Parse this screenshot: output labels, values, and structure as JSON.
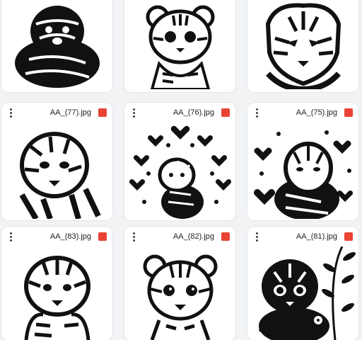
{
  "colors": {
    "background": "#f1f3f5",
    "card": "#ffffff",
    "image_badge": "#ea4335"
  },
  "files": [
    {
      "name": "",
      "icon": "image-icon"
    },
    {
      "name": "",
      "icon": "image-icon"
    },
    {
      "name": "",
      "icon": "image-icon"
    },
    {
      "name": "AA_(77).jpg",
      "icon": "image-icon"
    },
    {
      "name": "AA_(76).jpg",
      "icon": "image-icon"
    },
    {
      "name": "AA_(75).jpg",
      "icon": "image-icon"
    },
    {
      "name": "AA_(83).jpg",
      "icon": "image-icon"
    },
    {
      "name": "AA_(82).jpg",
      "icon": "image-icon"
    },
    {
      "name": "AA_(81).jpg",
      "icon": "image-icon"
    }
  ]
}
